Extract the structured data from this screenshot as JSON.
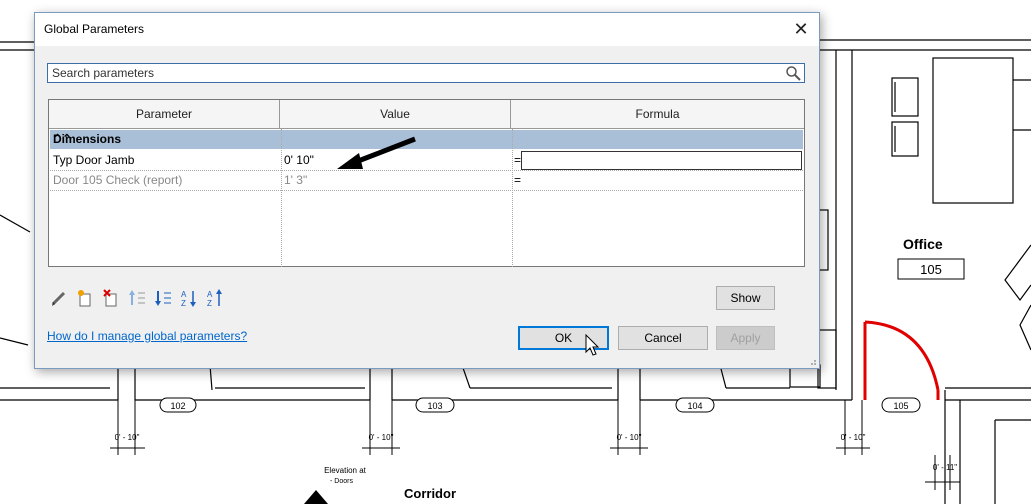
{
  "cad": {
    "room_name": "Office",
    "room_number": "105",
    "door_tags": [
      "102",
      "103",
      "104",
      "105"
    ],
    "dims": [
      "0' - 10\"",
      "0' - 10\"",
      "0' - 10\"",
      "0' - 10\"",
      "0' - 11\""
    ],
    "corridor": "Corridor",
    "elevation_line1": "Elevation at",
    "elevation_line2": "- Doors",
    "door_color": "#e00000"
  },
  "dialog": {
    "title": "Global Parameters",
    "close_glyph": "✕",
    "search_placeholder": "Search parameters",
    "columns": [
      "Parameter",
      "Value",
      "Formula"
    ],
    "group": {
      "label": "Dimensions",
      "collapse_glyph": "⌃⌃"
    },
    "rows": [
      {
        "parameter": "Typ Door Jamb",
        "value": "0'  10\"",
        "formula": "="
      },
      {
        "parameter": "Door 105 Check (report)",
        "value": "1'  3\"",
        "formula": "="
      }
    ],
    "toolbar": [
      "edit-icon",
      "new-parameter-icon",
      "delete-parameter-icon",
      "move-up-icon",
      "move-down-icon",
      "sort-ascending-icon",
      "sort-descending-icon"
    ],
    "show_label": "Show",
    "help_link": "How do I manage global parameters?",
    "ok_label": "OK",
    "cancel_label": "Cancel",
    "apply_label": "Apply",
    "group_color": "#a9bfd8"
  }
}
